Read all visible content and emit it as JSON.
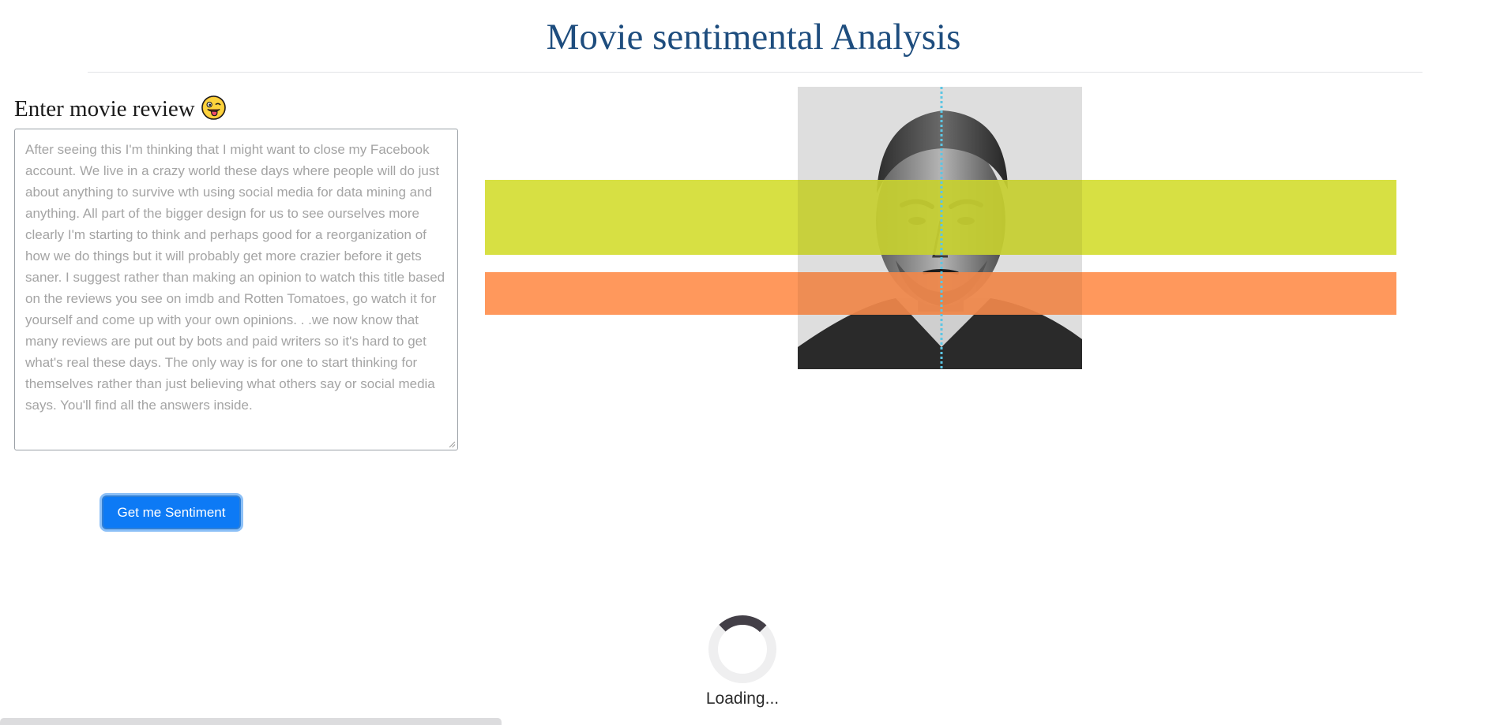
{
  "header": {
    "title": "Movie sentimental Analysis"
  },
  "form": {
    "heading": "Enter movie review",
    "heading_emoji": "winking-face-with-tongue-icon",
    "review_placeholder": "After seeing this I'm thinking that I might want to close my Facebook account. We live in a crazy world these days where people will do just about anything to survive wth using social media for data mining and anything. All part of the bigger design for us to see ourselves more clearly I'm starting to think and perhaps good for a reorganization of how we do things but it will probably get more crazier before it gets saner. I suggest rather than making an opinion to watch this title based on the reviews you see on imdb and Rotten Tomatoes, go watch it for yourself and come up with your own opinions. . .we now know that many reviews are put out by bots and paid writers so it's hard to get what's real these days. The only way is for one to start thinking for themselves rather than just believing what others say or social media says. You'll find all the answers inside.",
    "submit_label": "Get me Sentiment"
  },
  "status": {
    "loading_text": "Loading..."
  },
  "colors": {
    "title": "#1e4d7e",
    "button": "#0d7af5",
    "band_lime": "#d4de35",
    "band_orange": "#ff9050",
    "dotted_line": "#5cc6e4"
  }
}
